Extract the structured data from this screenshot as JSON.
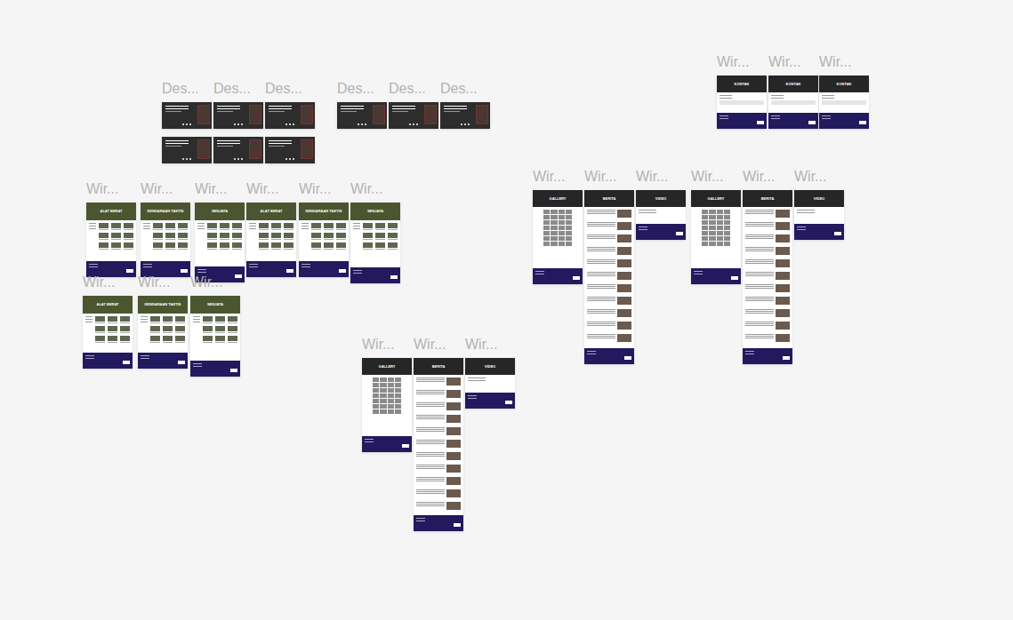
{
  "frames": [
    {
      "label": "Des...",
      "kind": "desktop"
    },
    {
      "label": "Des...",
      "kind": "desktop"
    },
    {
      "label": "Des...",
      "kind": "desktop"
    },
    {
      "kind": "desktop"
    },
    {
      "kind": "desktop"
    },
    {
      "kind": "desktop"
    },
    {
      "label": "Des...",
      "kind": "desktop"
    },
    {
      "label": "Des...",
      "kind": "desktop"
    },
    {
      "label": "Des...",
      "kind": "desktop"
    },
    {
      "label": "Wir...",
      "kind": "contact",
      "title": "KONTAK"
    },
    {
      "label": "Wir...",
      "kind": "contact",
      "title": "KONTAK"
    },
    {
      "label": "Wir...",
      "kind": "contact",
      "title": "KONTAK"
    },
    {
      "label": "Wir...",
      "kind": "product",
      "title": "ALAT BERAT"
    },
    {
      "label": "Wir...",
      "kind": "product",
      "title": "KENDARAAN TAKTIS"
    },
    {
      "label": "Wir...",
      "kind": "product",
      "title": "SENJATA"
    },
    {
      "label": "Wir...",
      "kind": "product",
      "title": "ALAT BERAT"
    },
    {
      "label": "Wir...",
      "kind": "product",
      "title": "KENDARAAN TAKTIS"
    },
    {
      "label": "Wir...",
      "kind": "product",
      "title": "SENJATA"
    },
    {
      "label": "Wir...",
      "kind": "product",
      "title": "ALAT BERAT"
    },
    {
      "label": "Wir...",
      "kind": "product",
      "title": "KENDARAAN TAKTIS"
    },
    {
      "label": "Wir...",
      "kind": "product",
      "title": "SENJATA"
    },
    {
      "label": "Wir...",
      "kind": "gallery",
      "title": "GALLERY"
    },
    {
      "label": "Wir...",
      "kind": "news",
      "title": "BERITA"
    },
    {
      "label": "Wir...",
      "kind": "video",
      "title": "VIDEO"
    },
    {
      "label": "Wir...",
      "kind": "gallery",
      "title": "GALLERY"
    },
    {
      "label": "Wir...",
      "kind": "news",
      "title": "BERITA"
    },
    {
      "label": "Wir...",
      "kind": "video",
      "title": "VIDEO"
    },
    {
      "label": "Wir...",
      "kind": "gallery",
      "title": "GALLERY"
    },
    {
      "label": "Wir...",
      "kind": "news",
      "title": "BERITA"
    },
    {
      "label": "Wir...",
      "kind": "video",
      "title": "VIDEO"
    }
  ]
}
